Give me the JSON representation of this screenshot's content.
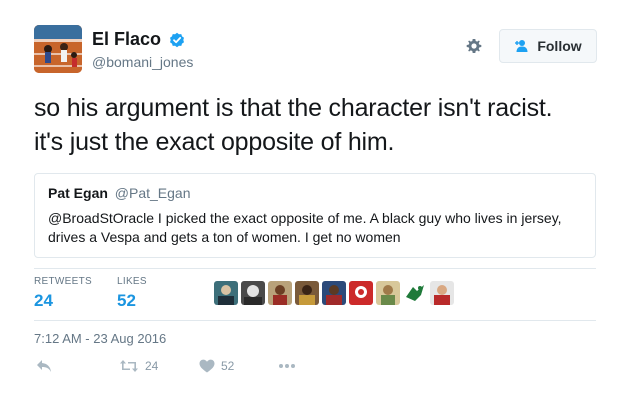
{
  "user": {
    "display_name": "El Flaco",
    "handle": "@bomani_jones"
  },
  "follow_button": {
    "label": "Follow"
  },
  "tweet": {
    "line1": "so his argument is that the character isn't racist.",
    "line2": "it's just the exact opposite of him."
  },
  "quoted_tweet": {
    "name": "Pat Egan",
    "handle": "@Pat_Egan",
    "line1": "@BroadStOracle I picked the exact opposite of me. A black guy who lives in jersey,",
    "line2": "drives a Vespa and gets a ton of women. I get no women"
  },
  "stats": {
    "retweets_label": "RETWEETS",
    "retweets_value": "24",
    "likes_label": "LIKES",
    "likes_value": "52"
  },
  "timestamp": "7:12 AM - 23 Aug 2016",
  "actions": {
    "retweet_count": "24",
    "like_count": "52"
  },
  "colors": {
    "accent": "#1b95e0",
    "verified": "#1da1f2",
    "muted": "#657786",
    "border": "#e1e8ed"
  },
  "icons": [
    "verified-badge-icon",
    "gear-icon",
    "follow-person-plus-icon",
    "reply-icon",
    "retweet-icon",
    "heart-icon",
    "more-icon"
  ]
}
